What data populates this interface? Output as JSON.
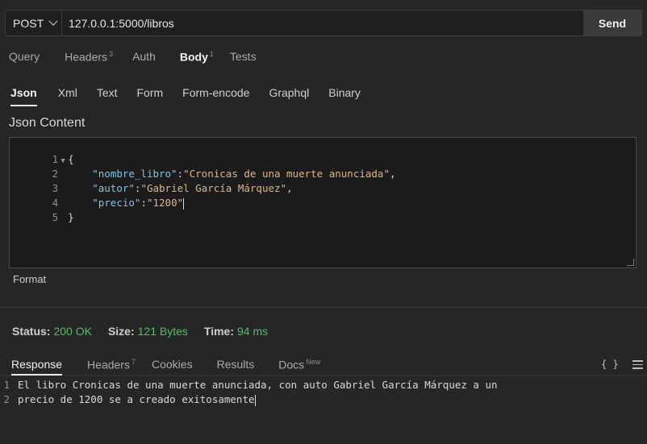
{
  "request": {
    "method": "POST",
    "url": "127.0.0.1:5000/libros",
    "send_label": "Send"
  },
  "request_tabs": [
    {
      "label": "Query",
      "badge": ""
    },
    {
      "label": "Headers",
      "badge": "3"
    },
    {
      "label": "Auth",
      "badge": ""
    },
    {
      "label": "Body",
      "badge": "1"
    },
    {
      "label": "Tests",
      "badge": ""
    }
  ],
  "body_tabs": [
    "Json",
    "Xml",
    "Text",
    "Form",
    "Form-encode",
    "Graphql",
    "Binary"
  ],
  "json_content_title": "Json Content",
  "editor": {
    "line_numbers": [
      "1",
      "2",
      "3",
      "4",
      "5"
    ],
    "open_brace": "{",
    "close_brace": "}",
    "fields": [
      {
        "key": "\"nombre_libro\"",
        "value": "\"Cronicas de una muerte anunciada\"",
        "trail": ","
      },
      {
        "key": "\"autor\"",
        "value": "\"Gabriel García Márquez\"",
        "trail": ","
      },
      {
        "key": "\"precio\"",
        "value": "\"1200\"",
        "trail": ""
      }
    ]
  },
  "format_label": "Format",
  "status": {
    "status_label": "Status:",
    "status_value": "200 OK",
    "size_label": "Size:",
    "size_value": "121 Bytes",
    "time_label": "Time:",
    "time_value": "94 ms",
    "color_ok": "#4fbf62"
  },
  "response_tabs": [
    {
      "label": "Response",
      "badge": ""
    },
    {
      "label": "Headers",
      "badge": "7"
    },
    {
      "label": "Cookies",
      "badge": ""
    },
    {
      "label": "Results",
      "badge": ""
    },
    {
      "label": "Docs",
      "badge": "New"
    }
  ],
  "response_icons": {
    "braces": "{ }",
    "menu": "hamburger-icon"
  },
  "response_body": {
    "line_numbers": [
      "1",
      "2"
    ],
    "lines": [
      "El libro Cronicas de una muerte anunciada, con auto Gabriel García Márquez a un",
      "precio de 1200 se a creado exitosamente"
    ]
  }
}
